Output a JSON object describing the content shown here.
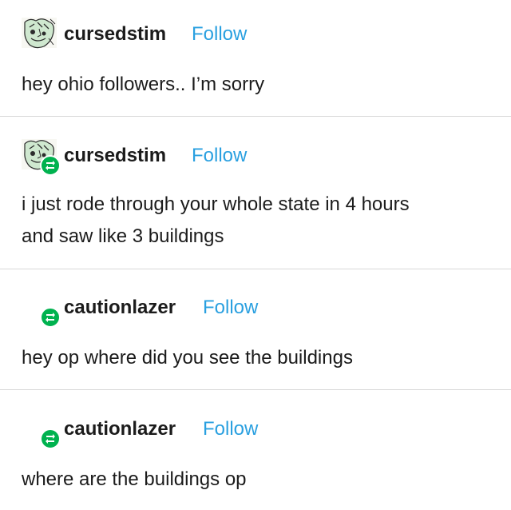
{
  "posts": [
    {
      "username": "cursedstim",
      "follow_label": "Follow",
      "text_lines": [
        "hey ohio followers.. I’m sorry"
      ],
      "avatar": "sketch-avatar-icon",
      "reblog_icon": false
    },
    {
      "username": "cursedstim",
      "follow_label": "Follow",
      "text_lines": [
        "i just rode through your whole state in 4 hours",
        "and saw like 3 buildings"
      ],
      "avatar": "sketch-avatar-icon",
      "reblog_icon": true
    },
    {
      "username": "cautionlazer",
      "follow_label": "Follow",
      "text_lines": [
        "hey op where did you see the buildings"
      ],
      "avatar": null,
      "reblog_icon": true
    },
    {
      "username": "cautionlazer",
      "follow_label": "Follow",
      "text_lines": [
        "where are the buildings op"
      ],
      "avatar": null,
      "reblog_icon": true
    }
  ],
  "colors": {
    "follow": "#2aa0e0",
    "reblog_badge": "#00b24f",
    "divider": "#d8d8d8",
    "text": "#1b1b1b"
  }
}
